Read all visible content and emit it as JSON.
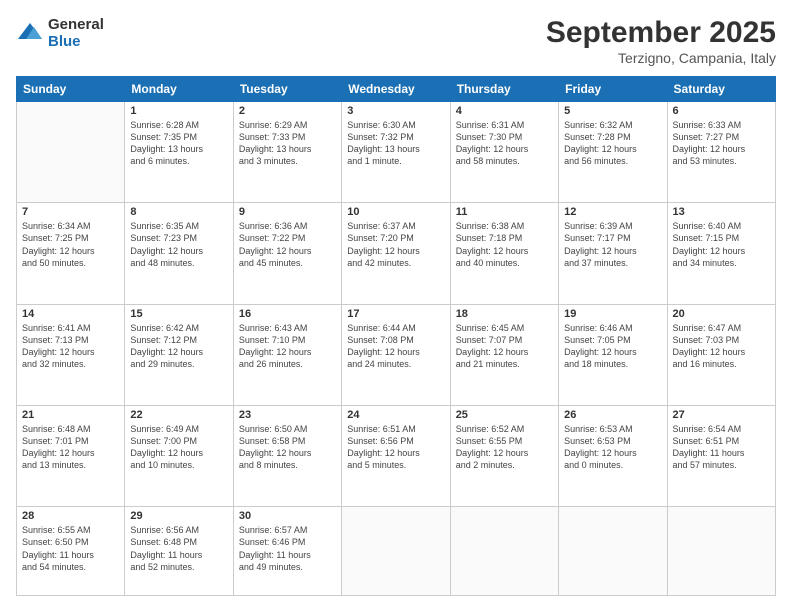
{
  "header": {
    "logo_line1": "General",
    "logo_line2": "Blue",
    "month": "September 2025",
    "location": "Terzigno, Campania, Italy"
  },
  "days_of_week": [
    "Sunday",
    "Monday",
    "Tuesday",
    "Wednesday",
    "Thursday",
    "Friday",
    "Saturday"
  ],
  "weeks": [
    [
      {
        "day": "",
        "info": ""
      },
      {
        "day": "1",
        "info": "Sunrise: 6:28 AM\nSunset: 7:35 PM\nDaylight: 13 hours\nand 6 minutes."
      },
      {
        "day": "2",
        "info": "Sunrise: 6:29 AM\nSunset: 7:33 PM\nDaylight: 13 hours\nand 3 minutes."
      },
      {
        "day": "3",
        "info": "Sunrise: 6:30 AM\nSunset: 7:32 PM\nDaylight: 13 hours\nand 1 minute."
      },
      {
        "day": "4",
        "info": "Sunrise: 6:31 AM\nSunset: 7:30 PM\nDaylight: 12 hours\nand 58 minutes."
      },
      {
        "day": "5",
        "info": "Sunrise: 6:32 AM\nSunset: 7:28 PM\nDaylight: 12 hours\nand 56 minutes."
      },
      {
        "day": "6",
        "info": "Sunrise: 6:33 AM\nSunset: 7:27 PM\nDaylight: 12 hours\nand 53 minutes."
      }
    ],
    [
      {
        "day": "7",
        "info": "Sunrise: 6:34 AM\nSunset: 7:25 PM\nDaylight: 12 hours\nand 50 minutes."
      },
      {
        "day": "8",
        "info": "Sunrise: 6:35 AM\nSunset: 7:23 PM\nDaylight: 12 hours\nand 48 minutes."
      },
      {
        "day": "9",
        "info": "Sunrise: 6:36 AM\nSunset: 7:22 PM\nDaylight: 12 hours\nand 45 minutes."
      },
      {
        "day": "10",
        "info": "Sunrise: 6:37 AM\nSunset: 7:20 PM\nDaylight: 12 hours\nand 42 minutes."
      },
      {
        "day": "11",
        "info": "Sunrise: 6:38 AM\nSunset: 7:18 PM\nDaylight: 12 hours\nand 40 minutes."
      },
      {
        "day": "12",
        "info": "Sunrise: 6:39 AM\nSunset: 7:17 PM\nDaylight: 12 hours\nand 37 minutes."
      },
      {
        "day": "13",
        "info": "Sunrise: 6:40 AM\nSunset: 7:15 PM\nDaylight: 12 hours\nand 34 minutes."
      }
    ],
    [
      {
        "day": "14",
        "info": "Sunrise: 6:41 AM\nSunset: 7:13 PM\nDaylight: 12 hours\nand 32 minutes."
      },
      {
        "day": "15",
        "info": "Sunrise: 6:42 AM\nSunset: 7:12 PM\nDaylight: 12 hours\nand 29 minutes."
      },
      {
        "day": "16",
        "info": "Sunrise: 6:43 AM\nSunset: 7:10 PM\nDaylight: 12 hours\nand 26 minutes."
      },
      {
        "day": "17",
        "info": "Sunrise: 6:44 AM\nSunset: 7:08 PM\nDaylight: 12 hours\nand 24 minutes."
      },
      {
        "day": "18",
        "info": "Sunrise: 6:45 AM\nSunset: 7:07 PM\nDaylight: 12 hours\nand 21 minutes."
      },
      {
        "day": "19",
        "info": "Sunrise: 6:46 AM\nSunset: 7:05 PM\nDaylight: 12 hours\nand 18 minutes."
      },
      {
        "day": "20",
        "info": "Sunrise: 6:47 AM\nSunset: 7:03 PM\nDaylight: 12 hours\nand 16 minutes."
      }
    ],
    [
      {
        "day": "21",
        "info": "Sunrise: 6:48 AM\nSunset: 7:01 PM\nDaylight: 12 hours\nand 13 minutes."
      },
      {
        "day": "22",
        "info": "Sunrise: 6:49 AM\nSunset: 7:00 PM\nDaylight: 12 hours\nand 10 minutes."
      },
      {
        "day": "23",
        "info": "Sunrise: 6:50 AM\nSunset: 6:58 PM\nDaylight: 12 hours\nand 8 minutes."
      },
      {
        "day": "24",
        "info": "Sunrise: 6:51 AM\nSunset: 6:56 PM\nDaylight: 12 hours\nand 5 minutes."
      },
      {
        "day": "25",
        "info": "Sunrise: 6:52 AM\nSunset: 6:55 PM\nDaylight: 12 hours\nand 2 minutes."
      },
      {
        "day": "26",
        "info": "Sunrise: 6:53 AM\nSunset: 6:53 PM\nDaylight: 12 hours\nand 0 minutes."
      },
      {
        "day": "27",
        "info": "Sunrise: 6:54 AM\nSunset: 6:51 PM\nDaylight: 11 hours\nand 57 minutes."
      }
    ],
    [
      {
        "day": "28",
        "info": "Sunrise: 6:55 AM\nSunset: 6:50 PM\nDaylight: 11 hours\nand 54 minutes."
      },
      {
        "day": "29",
        "info": "Sunrise: 6:56 AM\nSunset: 6:48 PM\nDaylight: 11 hours\nand 52 minutes."
      },
      {
        "day": "30",
        "info": "Sunrise: 6:57 AM\nSunset: 6:46 PM\nDaylight: 11 hours\nand 49 minutes."
      },
      {
        "day": "",
        "info": ""
      },
      {
        "day": "",
        "info": ""
      },
      {
        "day": "",
        "info": ""
      },
      {
        "day": "",
        "info": ""
      }
    ]
  ]
}
